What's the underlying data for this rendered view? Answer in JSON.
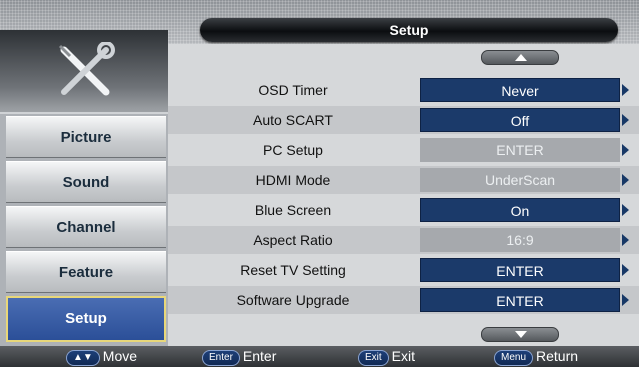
{
  "header": {
    "title": "Setup"
  },
  "sidebar": {
    "icon": "tools-icon",
    "items": [
      {
        "label": "Picture",
        "active": false
      },
      {
        "label": "Sound",
        "active": false
      },
      {
        "label": "Channel",
        "active": false
      },
      {
        "label": "Feature",
        "active": false
      },
      {
        "label": "Setup",
        "active": true
      }
    ]
  },
  "settings": [
    {
      "label": "OSD Timer",
      "value": "Never",
      "enabled": true
    },
    {
      "label": "Auto SCART",
      "value": "Off",
      "enabled": true
    },
    {
      "label": "PC Setup",
      "value": "ENTER",
      "enabled": false
    },
    {
      "label": "HDMI Mode",
      "value": "UnderScan",
      "enabled": false
    },
    {
      "label": "Blue Screen",
      "value": "On",
      "enabled": true
    },
    {
      "label": "Aspect Ratio",
      "value": "16:9",
      "enabled": false
    },
    {
      "label": "Reset TV Setting",
      "value": "ENTER",
      "enabled": true
    },
    {
      "label": "Software Upgrade",
      "value": "ENTER",
      "enabled": true
    }
  ],
  "footer": {
    "hints": [
      {
        "key": "▲▼",
        "label": "Move"
      },
      {
        "key": "Enter",
        "label": "Enter"
      },
      {
        "key": "Exit",
        "label": "Exit"
      },
      {
        "key": "Menu",
        "label": "Return"
      }
    ]
  },
  "colors": {
    "accent": "#1b3a6a",
    "active_nav": "#2b4f98",
    "disabled": "#a6a9ad"
  }
}
